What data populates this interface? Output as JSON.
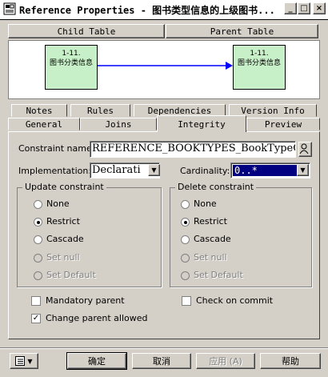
{
  "window": {
    "title": "Reference Properties - 图书类型信息的上级图书...",
    "buttons": {
      "minimize": "_",
      "maximize": "□",
      "close": "×"
    }
  },
  "diagram": {
    "child_header": "Child Table",
    "parent_header": "Parent Table",
    "child_table": {
      "line1": "1-11.",
      "line2": "图书分类信息"
    },
    "parent_table": {
      "line1": "1-11.",
      "line2": "图书分类信息"
    }
  },
  "tabs": {
    "top_row": [
      "Notes",
      "Rules",
      "Dependencies",
      "Version Info"
    ],
    "bottom_row": [
      "General",
      "Joins",
      "Integrity",
      "Preview"
    ],
    "active": "Integrity"
  },
  "integrity": {
    "constraint_name_label": "Constraint name:",
    "constraint_name_value": "REFERENCE_BOOKTYPES_BookTypeGUID",
    "implementation_label": "Implementation:",
    "implementation_value": "Declarati",
    "cardinality_label": "Cardinality:",
    "cardinality_value": "0..*",
    "update_constraint": {
      "legend": "Update constraint",
      "options": [
        "None",
        "Restrict",
        "Cascade",
        "Set null",
        "Set Default"
      ],
      "selected": "Restrict",
      "disabled": [
        "Set null",
        "Set Default"
      ]
    },
    "delete_constraint": {
      "legend": "Delete constraint",
      "options": [
        "None",
        "Restrict",
        "Cascade",
        "Set null",
        "Set Default"
      ],
      "selected": "Restrict",
      "disabled": [
        "Set null",
        "Set Default"
      ]
    },
    "mandatory_parent": {
      "label": "Mandatory parent",
      "checked": false
    },
    "change_parent_allowed": {
      "label": "Change parent allowed",
      "checked": true
    },
    "check_on_commit": {
      "label": "Check on commit",
      "checked": false
    }
  },
  "footer": {
    "ok": "确定",
    "cancel": "取消",
    "apply": "应用 (A)",
    "help": "帮助"
  },
  "colors": {
    "table_fill": "#c8f0c8",
    "link_arrow": "#0000ff",
    "input_highlight": "#000080"
  }
}
